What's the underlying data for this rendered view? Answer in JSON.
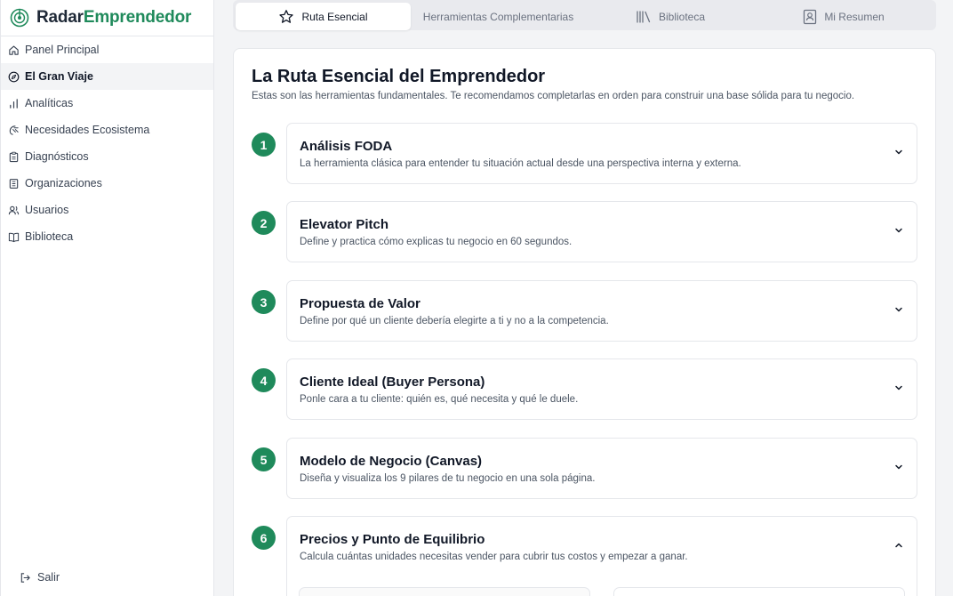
{
  "brand": {
    "part1": "Radar",
    "part2": "Emprendedor",
    "accent": "#1f8a5b"
  },
  "sidebar": {
    "items": [
      {
        "label": "Panel Principal",
        "icon": "home-icon"
      },
      {
        "label": "El Gran Viaje",
        "icon": "compass-icon",
        "active": true
      },
      {
        "label": "Analíticas",
        "icon": "bar-chart-icon"
      },
      {
        "label": "Necesidades Ecosistema",
        "icon": "ecosystem-icon"
      },
      {
        "label": "Diagnósticos",
        "icon": "clipboard-icon"
      },
      {
        "label": "Organizaciones",
        "icon": "building-icon"
      },
      {
        "label": "Usuarios",
        "icon": "users-icon"
      },
      {
        "label": "Biblioteca",
        "icon": "book-icon"
      }
    ],
    "logout_label": "Salir"
  },
  "tabs": [
    {
      "label": "Ruta Esencial",
      "icon": "star-icon",
      "active": true
    },
    {
      "label": "Herramientas Complementarias"
    },
    {
      "label": "Biblioteca",
      "icon": "library-icon"
    },
    {
      "label": "Mi Resumen",
      "icon": "profile-icon"
    }
  ],
  "main": {
    "title": "La Ruta Esencial del Emprendedor",
    "subtitle": "Estas son las herramientas fundamentales. Te recomendamos completarlas en orden para construir una base sólida para tu negocio.",
    "steps": [
      {
        "num": "1",
        "title": "Análisis FODA",
        "desc": "La herramienta clásica para entender tu situación actual desde una perspectiva interna y externa.",
        "expanded": false
      },
      {
        "num": "2",
        "title": "Elevator Pitch",
        "desc": "Define y practica cómo explicas tu negocio en 60 segundos.",
        "expanded": false
      },
      {
        "num": "3",
        "title": "Propuesta de Valor",
        "desc": "Define por qué un cliente debería elegirte a ti y no a la competencia.",
        "expanded": false
      },
      {
        "num": "4",
        "title": "Cliente Ideal (Buyer Persona)",
        "desc": "Ponle cara a tu cliente: quién es, qué necesita y qué le duele.",
        "expanded": false
      },
      {
        "num": "5",
        "title": "Modelo de Negocio (Canvas)",
        "desc": "Diseña y visualiza los 9 pilares de tu negocio en una sola página.",
        "expanded": false
      },
      {
        "num": "6",
        "title": "Precios y Punto de Equilibrio",
        "desc": "Calcula cuántas unidades necesitas vender para cubrir tus costos y empezar a ganar.",
        "expanded": true
      }
    ]
  }
}
